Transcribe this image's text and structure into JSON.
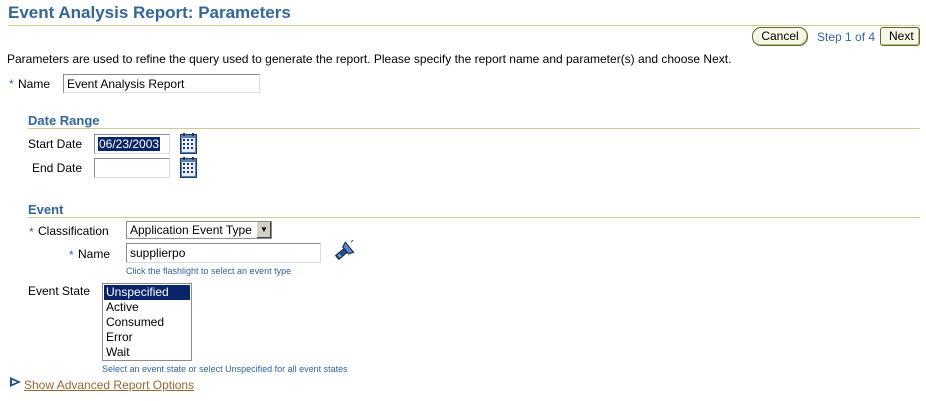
{
  "header": {
    "title": "Event Analysis Report: Parameters"
  },
  "train": {
    "cancel_label": "Cancel",
    "step_text": "Step 1 of 4",
    "next_label": "Next"
  },
  "intro": "Parameters are used to refine the query used to generate the report. Please specify the report name and parameter(s) and choose Next.",
  "required_marker": "*",
  "name_field": {
    "label": "Name",
    "value": "Event Analysis Report"
  },
  "date_range": {
    "heading": "Date Range",
    "start_label": "Start Date",
    "start_value": "06/23/2003",
    "end_label": "End Date",
    "end_value": ""
  },
  "event": {
    "heading": "Event",
    "classification_label": "Classification",
    "classification_value": "Application Event Type",
    "name_label": "Name",
    "name_value": "supplierpo",
    "name_hint": "Click the flashlight to select an event type",
    "state_label": "Event State",
    "states": [
      "Unspecified",
      "Active",
      "Consumed",
      "Error",
      "Wait"
    ],
    "selected_state": "Unspecified",
    "state_hint": "Select an event state or select Unspecified for all event states"
  },
  "advanced_link": "Show Advanced Report Options",
  "icons": {
    "calendar": "calendar-icon",
    "flashlight": "flashlight-icon",
    "disclosure": "disclosure-triangle-icon"
  },
  "colors": {
    "heading": "#336699",
    "rule": "#cccc99",
    "selection": "#0a246a",
    "link": "#996633"
  }
}
